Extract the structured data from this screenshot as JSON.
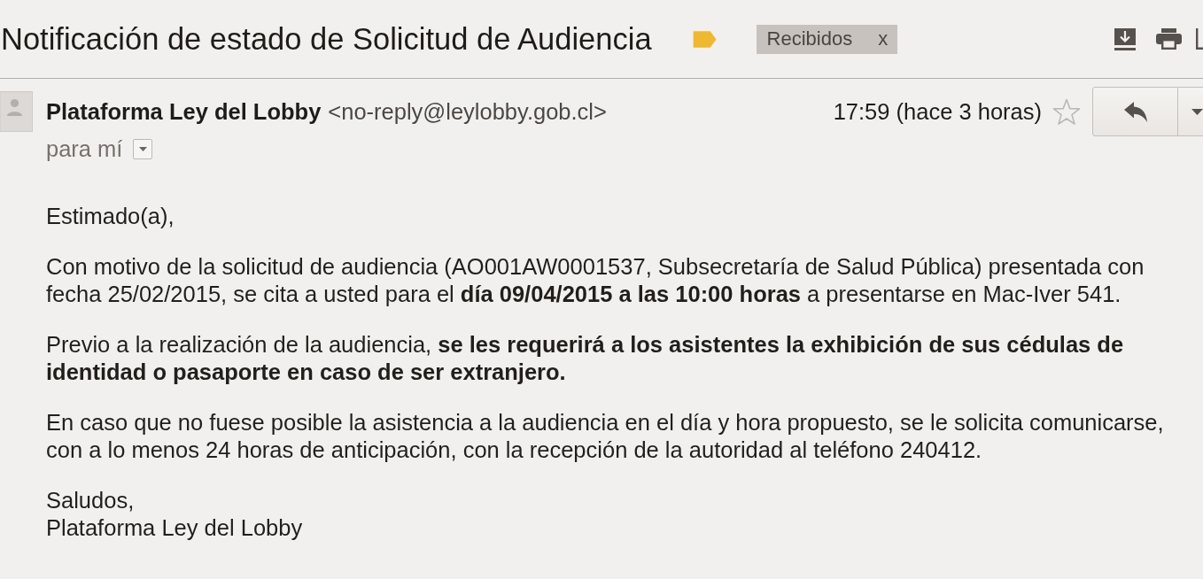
{
  "header": {
    "subject": "Notificación de estado de Solicitud de Audiencia",
    "important": true,
    "labels": [
      {
        "text": "Recibidos",
        "remove": "x"
      }
    ]
  },
  "sender": {
    "name": "Plataforma Ley del Lobby",
    "email": "<no-reply@leylobby.gob.cl>",
    "time": "17:59 (hace 3 horas)",
    "starred": false,
    "recipient": "para mí"
  },
  "body": {
    "greeting": "Estimado(a),",
    "paragraphs": [
      "Con motivo de la solicitud de audiencia (AO001AW0001537, Subsecretaría de Salud Pública) presentada con fecha 25/02/2015, se cita a usted para el **día 09/04/2015 a las 10:00 horas** a presentarse en Mac-Iver 541.",
      "Previo a la realización de la audiencia, **se les requerirá a los asistentes la exhibición de sus cédulas de identidad o pasaporte en caso de ser extranjero.**",
      "En caso que no fuese posible la asistencia a la audiencia en el día y hora propuesto, se le solicita comunicarse, con a lo menos 24 horas de anticipación, con la recepción de la autoridad al teléfono 240412."
    ],
    "closing": [
      "Saludos,",
      "Plataforma Ley del Lobby"
    ]
  }
}
